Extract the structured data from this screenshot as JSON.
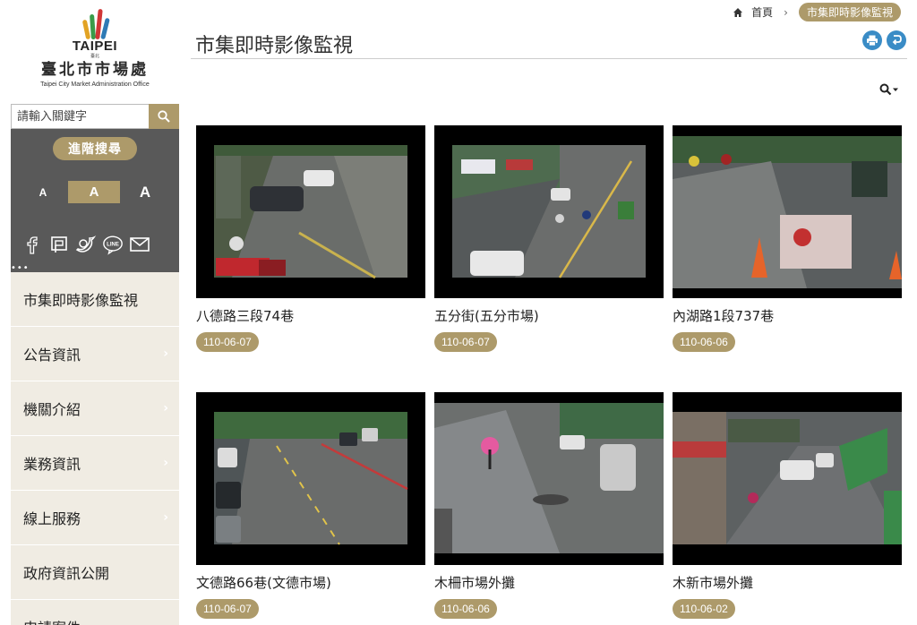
{
  "logo": {
    "brand": "TAIPEI",
    "brand_sub": "臺北",
    "name": "臺北市市場處",
    "english": "Taipei City Market Administration Office"
  },
  "search": {
    "placeholder": "請輸入關鍵字",
    "advanced_label": "進階搜尋"
  },
  "font_sizes": {
    "small": "A",
    "medium": "A",
    "large": "A"
  },
  "socials": [
    "facebook-icon",
    "plurk-icon",
    "twitter-icon",
    "line-icon",
    "mail-icon"
  ],
  "more_dots": "•••",
  "menu": [
    {
      "label": "市集即時影像監視"
    },
    {
      "label": "公告資訊"
    },
    {
      "label": "機關介紹"
    },
    {
      "label": "業務資訊"
    },
    {
      "label": "線上服務"
    },
    {
      "label": "政府資訊公開"
    },
    {
      "label": "申請案件"
    }
  ],
  "breadcrumb": {
    "home": "首頁",
    "separator": "›",
    "current": "市集即時影像監視"
  },
  "page_title": "市集即時影像監視",
  "cameras": [
    {
      "title": "八德路三段74巷",
      "date": "110-06-07"
    },
    {
      "title": "五分街(五分市場)",
      "date": "110-06-07"
    },
    {
      "title": "內湖路1段737巷",
      "date": "110-06-06"
    },
    {
      "title": "文德路66巷(文德市場)",
      "date": "110-06-07"
    },
    {
      "title": "木柵市場外攤",
      "date": "110-06-06"
    },
    {
      "title": "木新市場外攤",
      "date": "110-06-02"
    }
  ],
  "colors": {
    "accent_gold": "#ad9a6a",
    "sidebar_dark": "#595959",
    "menu_bg": "#f0ece3",
    "icon_blue": "#3a8cc6"
  }
}
